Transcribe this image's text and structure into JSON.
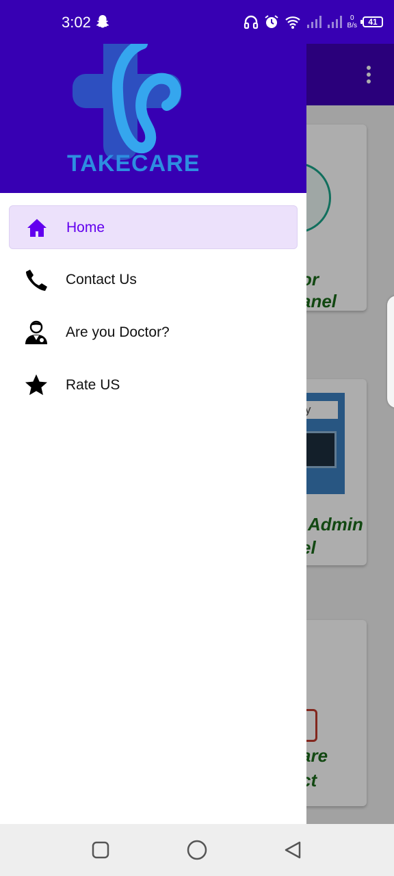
{
  "status_bar": {
    "time": "3:02",
    "net_speed_value": "0",
    "net_speed_unit": "B/s",
    "battery": "41",
    "icons": [
      "snapchat-icon",
      "headphones-icon",
      "alarm-icon",
      "wifi-icon",
      "signal-icon",
      "signal-icon",
      "battery-icon"
    ]
  },
  "colors": {
    "primary": "#3700b3",
    "accent": "#6200ee",
    "active_bg": "#ece1fb",
    "logo_blue": "#2d8ee0"
  },
  "drawer": {
    "logo_text": "TAKECARE",
    "items": [
      {
        "label": "Home",
        "icon": "home-icon",
        "active": true
      },
      {
        "label": "Contact Us",
        "icon": "phone-icon",
        "active": false
      },
      {
        "label": "Are you Doctor?",
        "icon": "doctor-icon",
        "active": false
      },
      {
        "label": "Rate US",
        "icon": "star-icon",
        "active": false
      }
    ]
  },
  "background": {
    "cards": [
      {
        "line1": "or",
        "line2": "anel"
      },
      {
        "sign": "acy",
        "line1": "Admin",
        "line2": "el"
      },
      {
        "line1": "are",
        "line2": "ct"
      }
    ]
  },
  "nav_bar": {
    "buttons": [
      "recent-apps-icon",
      "home-circle-icon",
      "back-triangle-icon"
    ]
  }
}
